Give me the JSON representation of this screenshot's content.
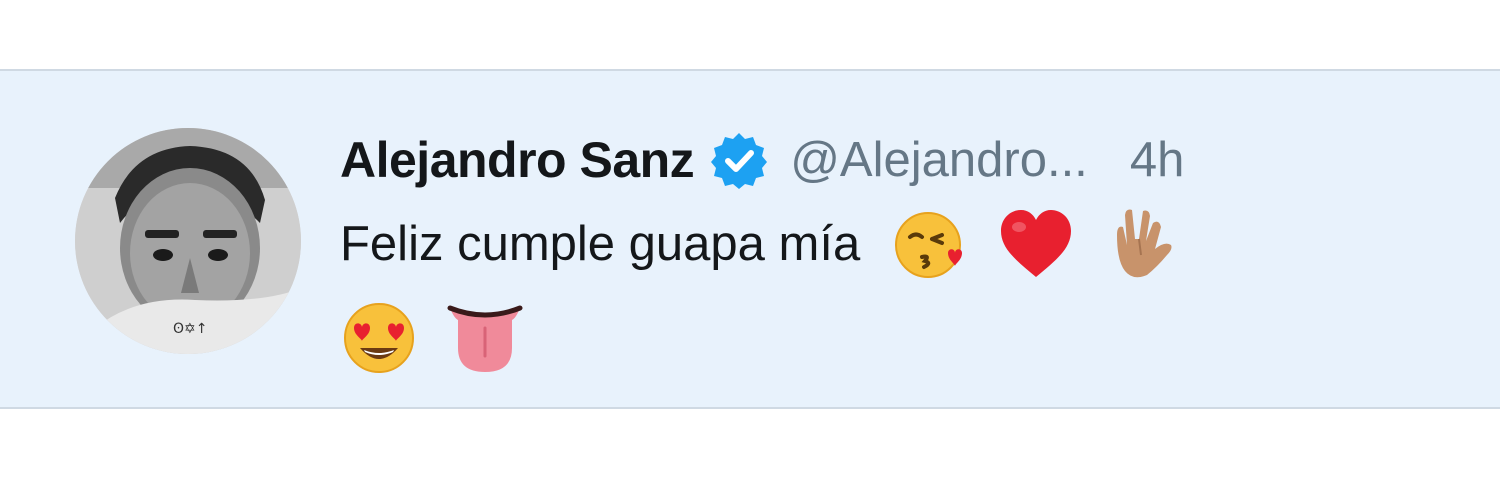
{
  "tweet": {
    "display_name": "Alejandro Sanz",
    "handle": "@Alejandro...",
    "time": "4h",
    "text": "Feliz cumple guapa mía",
    "verified_icon": "verified-badge-icon",
    "avatar": "profile-photo-avatar",
    "emojis": [
      "kissing-face-with-heart-emoji",
      "red-heart-emoji",
      "vulcan-salute-emoji",
      "heart-eyes-emoji",
      "tongue-emoji"
    ]
  },
  "colors": {
    "background": "#ffffff",
    "tweet_highlight": "#e8f2fc",
    "verified": "#1da1f2",
    "name": "#14171a",
    "muted": "#657786"
  }
}
